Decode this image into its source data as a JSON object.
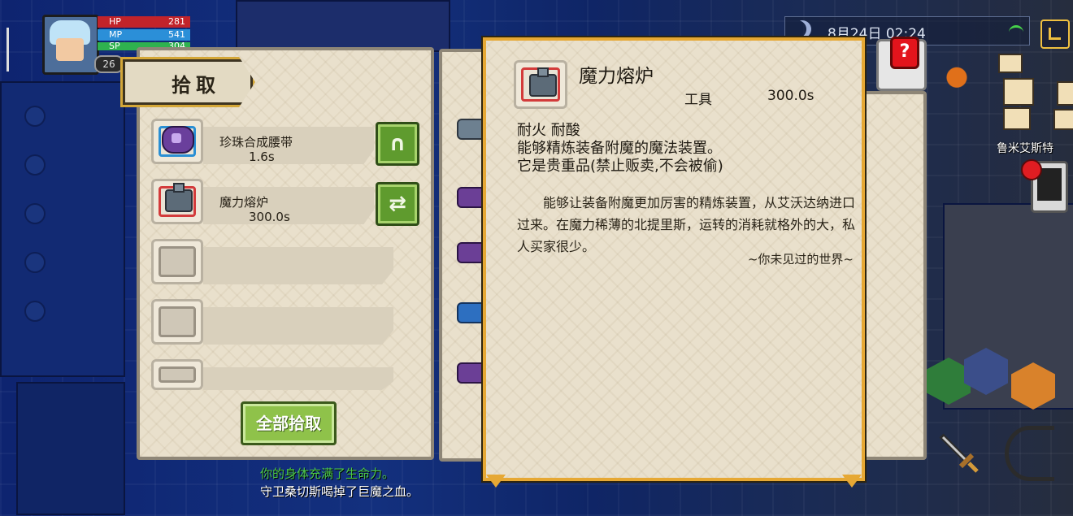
{
  "hud": {
    "level": "26",
    "hp": {
      "label": "HP",
      "value": "281"
    },
    "mp": {
      "label": "MP",
      "value": "541"
    },
    "sp": {
      "label": "SP",
      "value": "304"
    },
    "clock": "8月24日  02:24",
    "town_name": "鲁米艾斯特"
  },
  "pickup": {
    "title": "拾取",
    "items": [
      {
        "name": "珍珠合成腰带",
        "time": "1.6s"
      },
      {
        "name": "魔力熔炉",
        "time": "300.0s"
      }
    ],
    "pickup_all_label": "全部拾取"
  },
  "tooltip": {
    "name": "魔力熔炉",
    "type": "工具",
    "time": "300.0s",
    "attr_line1": "耐火  耐酸",
    "attr_line2": "能够精炼装备附魔的魔法装置。",
    "attr_line3": "它是贵重品(禁止贩卖,不会被偷)",
    "description": "能够让装备附魔更加厉害的精炼装置，从艾沃达纳进口过来。在魔力稀薄的北提里斯，运转的消耗就格外的大，私人买家很少。",
    "source": "~你未见过的世界~"
  },
  "log": [
    "你的身体充满了生命力。",
    "守卫桑切斯喝掉了巨魔之血。"
  ],
  "colors": {
    "tooltip_border": "#e6a834",
    "button_green": "#5f9b2e",
    "hp_red": "#c2232a",
    "mp_blue": "#2b8fd8",
    "sp_green": "#2fb24f"
  },
  "icons": [
    "belt-icon",
    "furnace-icon",
    "equip-icon",
    "swap-icon",
    "moon-icon",
    "wifi-icon",
    "exit-icon",
    "hint-icon",
    "phone-icon",
    "sword-icon",
    "bow-icon"
  ]
}
